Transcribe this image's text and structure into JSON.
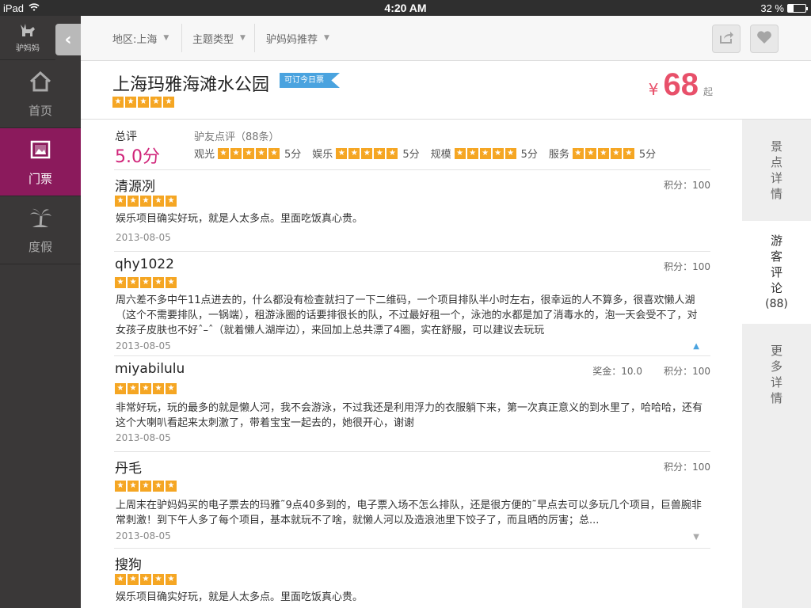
{
  "status": {
    "device": "iPad",
    "time": "4:20 AM",
    "battery": "32 %"
  },
  "sidebar": {
    "logo_text": "驴妈妈",
    "items": [
      {
        "label": "首页",
        "icon": "home-icon"
      },
      {
        "label": "门票",
        "icon": "ticket-picture-icon"
      },
      {
        "label": "度假",
        "icon": "palm-tree-icon"
      }
    ]
  },
  "filters": [
    {
      "label": "地区:上海"
    },
    {
      "label": "主题类型"
    },
    {
      "label": "驴妈妈推荐"
    }
  ],
  "attraction": {
    "title": "上海玛雅海滩水公园",
    "badge": "可订今日票",
    "price_symbol": "¥",
    "price": "68",
    "price_suffix": "起"
  },
  "summary": {
    "overall_label": "总评",
    "overall_value": "5.0分",
    "count_label": "驴友点评（88条）",
    "categories": [
      {
        "label": "观光",
        "score": "5分"
      },
      {
        "label": "娱乐",
        "score": "5分"
      },
      {
        "label": "规模",
        "score": "5分"
      },
      {
        "label": "服务",
        "score": "5分"
      }
    ]
  },
  "reviews": [
    {
      "user": "清源冽",
      "bonus": "",
      "points": "积分：100",
      "text": "娱乐项目确实好玩，就是人太多点。里面吃饭真心贵。",
      "date": "2013-08-05",
      "toggle": ""
    },
    {
      "user": "qhy1022",
      "bonus": "",
      "points": "积分：100",
      "text": "周六差不多中午11点进去的，什么都没有检查就扫了一下二维码，一个项目排队半小时左右，很幸运的人不算多，很喜欢懒人湖（这个不需要排队，一锅端），租游泳圈的话要排很长的队，不过最好租一个，泳池的水都是加了消毒水的，泡一天会受不了，对女孩子皮肤也不好ˆ–ˆ（就着懒人湖岸边），来回加上总共漂了4圈，实在舒服，可以建议去玩玩",
      "date": "2013-08-05",
      "toggle": "▲"
    },
    {
      "user": "miyabilulu",
      "bonus": "奖金：10.0",
      "points": "积分：100",
      "text": "非常好玩，玩的最多的就是懒人河，我不会游泳，不过我还是利用浮力的衣服躺下来，第一次真正意义的到水里了，哈哈哈，还有这个大喇叭看起来太刺激了，带着宝宝一起去的，她很开心，谢谢",
      "date": "2013-08-05",
      "toggle": ""
    },
    {
      "user": "丹毛",
      "bonus": "",
      "points": "积分：100",
      "text": "上周末在驴妈妈买的电子票去的玛雅˜9点40多到的，电子票入场不怎么排队，还是很方便的˜早点去可以多玩几个项目，巨兽腕非常刺激！到下午人多了每个项目，基本就玩不了啥，就懒人河以及造浪池里下饺子了，而且晒的厉害；总...",
      "date": "2013-08-05",
      "toggle": "▼"
    },
    {
      "user": "搜狗",
      "bonus": "",
      "points": "",
      "text": "娱乐项目确实好玩，就是人太多点。里面吃饭真心贵。",
      "date": "",
      "toggle": ""
    }
  ],
  "right_tabs": [
    {
      "label": "景点详情",
      "sub": ""
    },
    {
      "label": "游客评论",
      "sub": "(88)"
    },
    {
      "label": "更多详情",
      "sub": ""
    }
  ],
  "colors": {
    "accent": "#d0257a",
    "active_nav": "#8b1a5c",
    "price": "#e8506a",
    "star": "#f5a623",
    "badge": "#4aa3df"
  }
}
